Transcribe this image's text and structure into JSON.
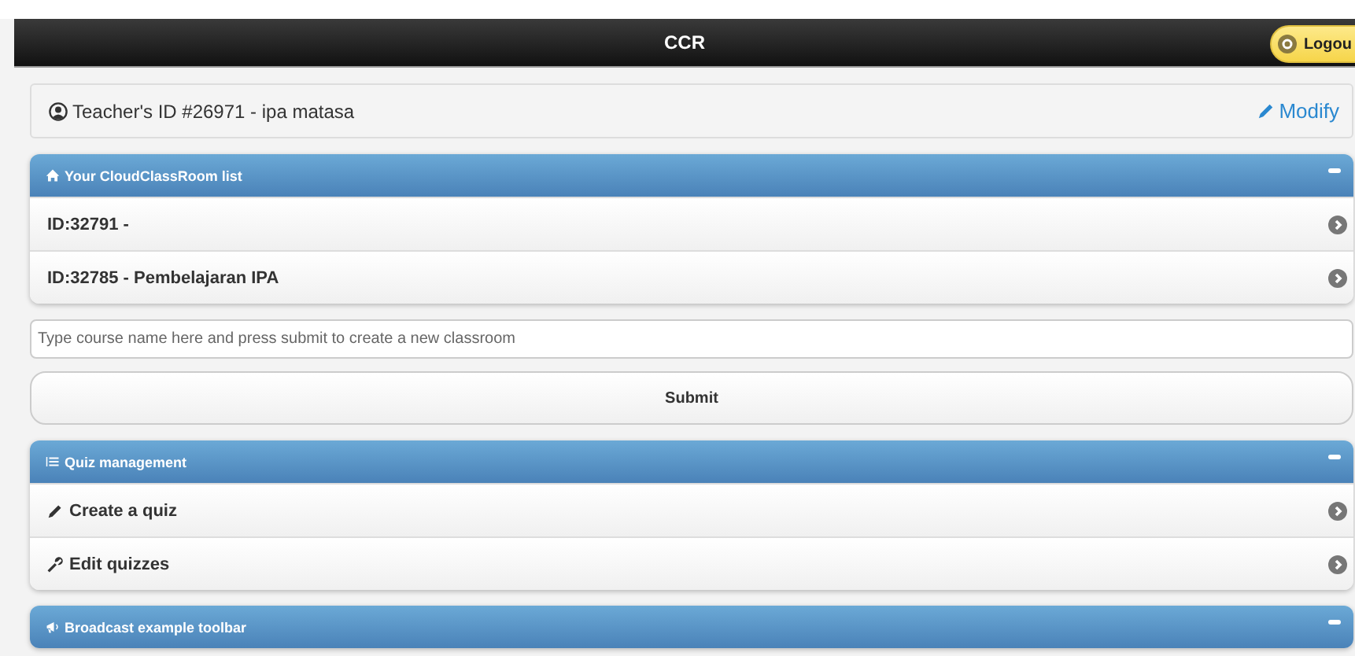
{
  "header": {
    "title": "CCR",
    "logout": "Logou"
  },
  "teacher": {
    "label": "Teacher's ID #26971 - ipa matasa",
    "modify": "Modify"
  },
  "classrooms": {
    "title": "Your CloudClassRoom list",
    "expanded": true,
    "items": [
      {
        "label": "ID:32791 -"
      },
      {
        "label": "ID:32785 - Pembelajaran IPA"
      }
    ]
  },
  "new_classroom": {
    "placeholder": "Type course name here and press submit to create a new classroom",
    "submit": "Submit"
  },
  "quiz": {
    "title": "Quiz management",
    "expanded": true,
    "items": [
      {
        "kind": "pencil",
        "label": "Create a quiz"
      },
      {
        "kind": "wrench",
        "label": "Edit quizzes"
      }
    ]
  },
  "broadcast": {
    "title": "Broadcast example toolbar",
    "expanded": true
  }
}
